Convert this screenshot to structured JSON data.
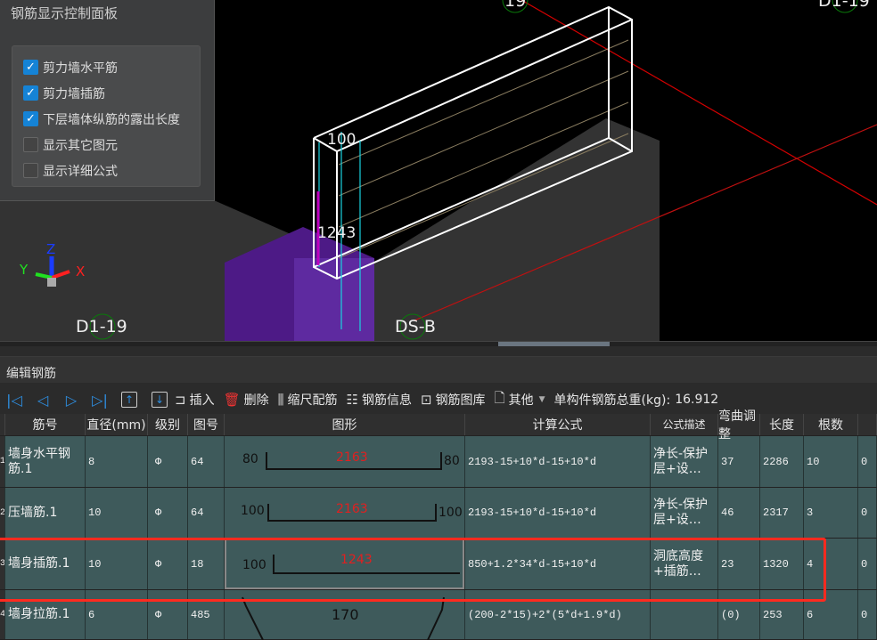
{
  "viewport": {
    "axis_labels": [
      "19",
      "D1-19",
      "D1-19",
      "DS-B"
    ],
    "dims": {
      "top": "100",
      "side": "1243"
    },
    "gizmo": {
      "x": "X",
      "y": "Y",
      "z": "Z"
    },
    "colors": {
      "axis_line": "#d40000",
      "rebar": "#ffffff",
      "insert_bar": "#c000c0",
      "column": "#5a1f9a"
    }
  },
  "panel": {
    "title": "钢筋显示控制面板",
    "options": [
      {
        "label": "剪力墙水平筋",
        "checked": true
      },
      {
        "label": "剪力墙插筋",
        "checked": true
      },
      {
        "label": "下层墙体纵筋的露出长度",
        "checked": true
      },
      {
        "label": "显示其它图元",
        "checked": false
      },
      {
        "label": "显示详细公式",
        "checked": false
      }
    ]
  },
  "section": {
    "title": "编辑钢筋"
  },
  "toolbar": {
    "insert": "插入",
    "delete": "删除",
    "scale": "缩尺配筋",
    "info": "钢筋信息",
    "library": "钢筋图库",
    "other": "其他",
    "weight_label": "单构件钢筋总重(kg):",
    "weight_value": "16.912"
  },
  "table": {
    "headers": [
      "筋号",
      "直径(mm)",
      "级别",
      "图号",
      "图形",
      "计算公式",
      "公式描述",
      "弯曲调整",
      "长度",
      "根数",
      ""
    ],
    "rows": [
      {
        "num": "1",
        "name": "墙身水平钢筋.1",
        "dia": "8",
        "grade": "Φ",
        "fig": "64",
        "shape": {
          "left": "80",
          "mid": "2163",
          "right": "80"
        },
        "formula": "2193-15+10*d-15+10*d",
        "desc": "净长-保护层+设…",
        "bend": "37",
        "len": "2286",
        "count": "10",
        "extra": "0"
      },
      {
        "num": "2",
        "name": "压墙筋.1",
        "dia": "10",
        "grade": "Φ",
        "fig": "64",
        "shape": {
          "left": "100",
          "mid": "2163",
          "right": "100"
        },
        "formula": "2193-15+10*d-15+10*d",
        "desc": "净长-保护层+设…",
        "bend": "46",
        "len": "2317",
        "count": "3",
        "extra": "0"
      },
      {
        "num": "3",
        "name": "墙身插筋.1",
        "dia": "10",
        "grade": "Φ",
        "fig": "18",
        "shape": {
          "left": "100",
          "mid": "1243",
          "right": ""
        },
        "formula": "850+1.2*34*d-15+10*d",
        "desc": "洞底高度+插筋…",
        "bend": "23",
        "len": "1320",
        "count": "4",
        "extra": "0",
        "highlighted": true
      },
      {
        "num": "4",
        "name": "墙身拉筋.1",
        "dia": "6",
        "grade": "Φ",
        "fig": "485",
        "shape": {
          "left": "",
          "mid": "170",
          "right": ""
        },
        "formula": "(200-2*15)+2*(5*d+1.9*d)",
        "desc": "",
        "bend": "(0)",
        "len": "253",
        "count": "6",
        "extra": "0"
      }
    ]
  }
}
